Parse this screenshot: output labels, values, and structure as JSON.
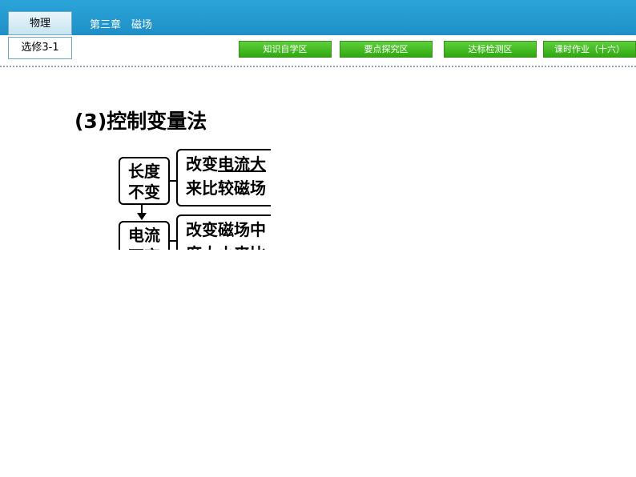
{
  "header": {
    "subject": "物理",
    "chapter": "第三章　磁场",
    "module": "选修3-1"
  },
  "nav": {
    "buttons": [
      "知识自学区",
      "要点探究区",
      "达标检测区",
      "课时作业（十六）"
    ]
  },
  "content": {
    "heading": "(3)控制变量法",
    "diagram": {
      "row1": {
        "condition_line1": "长度",
        "condition_line2": "不变",
        "desc_line1_prefix": "改变",
        "desc_line1_underlined": "电流大",
        "desc_line2": "来比较磁场"
      },
      "row2": {
        "condition_line1": "电流",
        "condition_line2": "不变",
        "desc_line1": "改变磁场中",
        "desc_line2": "度大小来比"
      }
    }
  },
  "colors": {
    "header_blue": "#2ba5d9",
    "nav_green": "#3cb51a"
  }
}
